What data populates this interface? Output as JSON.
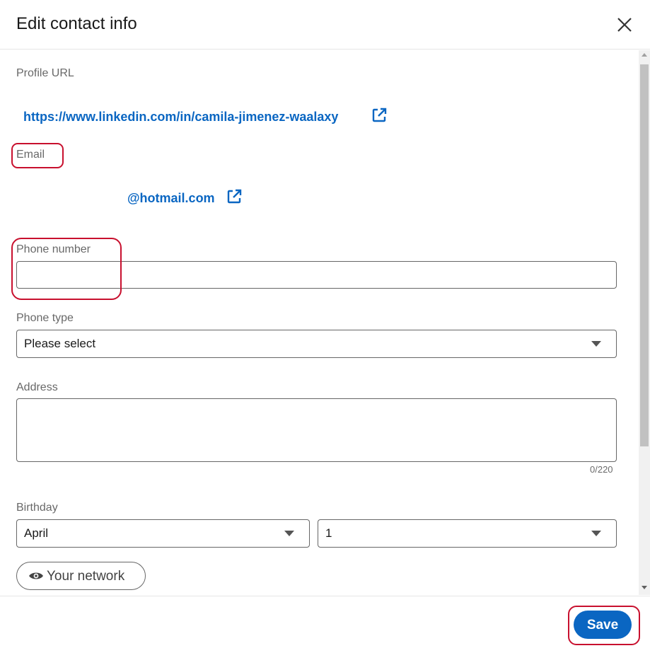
{
  "dialog": {
    "title": "Edit contact info",
    "close_icon": "close-icon"
  },
  "profile_url": {
    "label": "Profile URL",
    "link_text": "https://www.linkedin.com/in/camila-jimenez-waalaxy",
    "icon": "external-link-icon"
  },
  "email": {
    "label": "Email",
    "link_text": "@hotmail.com",
    "icon": "external-link-icon"
  },
  "phone_number": {
    "label": "Phone number",
    "value": ""
  },
  "phone_type": {
    "label": "Phone type",
    "selected": "Please select"
  },
  "address": {
    "label": "Address",
    "value": "",
    "counter": "0/220"
  },
  "birthday": {
    "label": "Birthday",
    "month": "April",
    "day": "1"
  },
  "visibility": {
    "label": "Your network",
    "icon": "eye-icon"
  },
  "footer": {
    "save_label": "Save"
  },
  "colors": {
    "link": "#0a66c2",
    "primary_button": "#0a66c2",
    "annotation": "#c8102e"
  }
}
